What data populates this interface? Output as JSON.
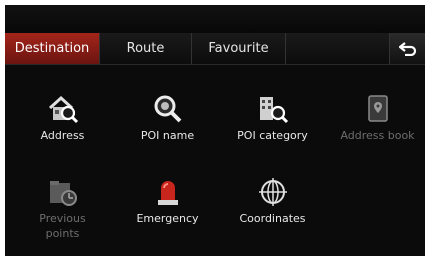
{
  "tabs": [
    {
      "label": "Destination",
      "active": true
    },
    {
      "label": "Route",
      "active": false
    },
    {
      "label": "Favourite",
      "active": false
    }
  ],
  "back_icon": "back-arrow-icon",
  "menu_items": [
    {
      "label": "Address",
      "icon": "house-search-icon",
      "enabled": true
    },
    {
      "label": "POI name",
      "icon": "magnifier-icon",
      "enabled": true
    },
    {
      "label": "POI category",
      "icon": "building-search-icon",
      "enabled": true
    },
    {
      "label": "Address book",
      "icon": "address-book-icon",
      "enabled": false
    },
    {
      "label": "Previous\npoints",
      "icon": "previous-points-icon",
      "enabled": false
    },
    {
      "label": "Emergency",
      "icon": "emergency-light-icon",
      "enabled": true
    },
    {
      "label": "Coordinates",
      "icon": "crosshair-globe-icon",
      "enabled": true
    }
  ],
  "colors": {
    "active_tab": "#a4251a",
    "background": "#0b0b0b",
    "text": "#e8e8e8",
    "disabled_text": "#6d6d6d"
  }
}
